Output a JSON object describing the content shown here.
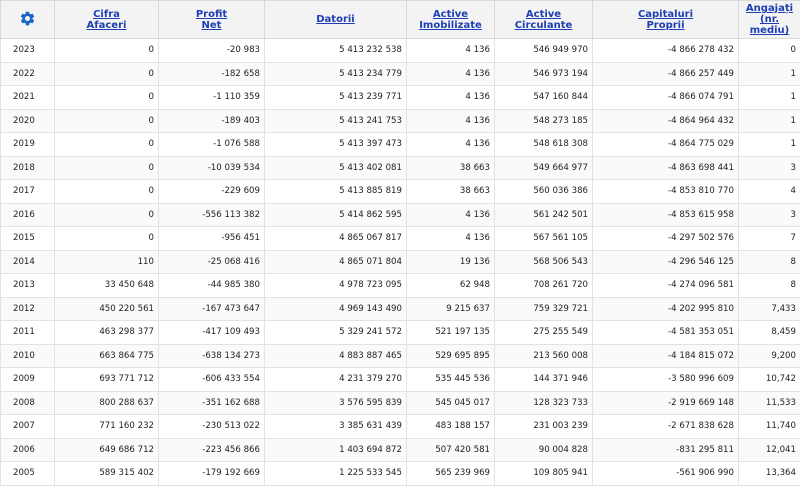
{
  "settings_icon": "gear-icon",
  "accent_color": "#1d3fb3",
  "headers": [
    {
      "l1": "Cifra",
      "l2": "Afaceri"
    },
    {
      "l1": "Profit",
      "l2": "Net"
    },
    {
      "l1": "Datorii",
      "l2": ""
    },
    {
      "l1": "Active",
      "l2": "Imobilizate"
    },
    {
      "l1": "Active",
      "l2": "Circulante"
    },
    {
      "l1": "Capitaluri",
      "l2": "Proprii"
    },
    {
      "l1": "Angajați",
      "l2": "(nr. mediu)"
    }
  ],
  "rows": [
    [
      "2023",
      "0",
      "-20 983",
      "5 413 232 538",
      "4 136",
      "546 949 970",
      "-4 866 278 432",
      "0"
    ],
    [
      "2022",
      "0",
      "-182 658",
      "5 413 234 779",
      "4 136",
      "546 973 194",
      "-4 866 257 449",
      "1"
    ],
    [
      "2021",
      "0",
      "-1 110 359",
      "5 413 239 771",
      "4 136",
      "547 160 844",
      "-4 866 074 791",
      "1"
    ],
    [
      "2020",
      "0",
      "-189 403",
      "5 413 241 753",
      "4 136",
      "548 273 185",
      "-4 864 964 432",
      "1"
    ],
    [
      "2019",
      "0",
      "-1 076 588",
      "5 413 397 473",
      "4 136",
      "548 618 308",
      "-4 864 775 029",
      "1"
    ],
    [
      "2018",
      "0",
      "-10 039 534",
      "5 413 402 081",
      "38 663",
      "549 664 977",
      "-4 863 698 441",
      "3"
    ],
    [
      "2017",
      "0",
      "-229 609",
      "5 413 885 819",
      "38 663",
      "560 036 386",
      "-4 853 810 770",
      "4"
    ],
    [
      "2016",
      "0",
      "-556 113 382",
      "5 414 862 595",
      "4 136",
      "561 242 501",
      "-4 853 615 958",
      "3"
    ],
    [
      "2015",
      "0",
      "-956 451",
      "4 865 067 817",
      "4 136",
      "567 561 105",
      "-4 297 502 576",
      "7"
    ],
    [
      "2014",
      "110",
      "-25 068 416",
      "4 865 071 804",
      "19 136",
      "568 506 543",
      "-4 296 546 125",
      "8"
    ],
    [
      "2013",
      "33 450 648",
      "-44 985 380",
      "4 978 723 095",
      "62 948",
      "708 261 720",
      "-4 274 096 581",
      "8"
    ],
    [
      "2012",
      "450 220 561",
      "-167 473 647",
      "4 969 143 490",
      "9 215 637",
      "759 329 721",
      "-4 202 995 810",
      "7,433"
    ],
    [
      "2011",
      "463 298 377",
      "-417 109 493",
      "5 329 241 572",
      "521 197 135",
      "275 255 549",
      "-4 581 353 051",
      "8,459"
    ],
    [
      "2010",
      "663 864 775",
      "-638 134 273",
      "4 883 887 465",
      "529 695 895",
      "213 560 008",
      "-4 184 815 072",
      "9,200"
    ],
    [
      "2009",
      "693 771 712",
      "-606 433 554",
      "4 231 379 270",
      "535 445 536",
      "144 371 946",
      "-3 580 996 609",
      "10,742"
    ],
    [
      "2008",
      "800 288 637",
      "-351 162 688",
      "3 576 595 839",
      "545 045 017",
      "128 323 733",
      "-2 919 669 148",
      "11,533"
    ],
    [
      "2007",
      "771 160 232",
      "-230 513 022",
      "3 385 631 439",
      "483 188 157",
      "231 003 239",
      "-2 671 838 628",
      "11,740"
    ],
    [
      "2006",
      "649 686 712",
      "-223 456 866",
      "1 403 694 872",
      "507 420 581",
      "90 004 828",
      "-831 295 811",
      "12,041"
    ],
    [
      "2005",
      "589 315 402",
      "-179 192 669",
      "1 225 533 545",
      "565 239 969",
      "109 805 941",
      "-561 906 990",
      "13,364"
    ]
  ]
}
